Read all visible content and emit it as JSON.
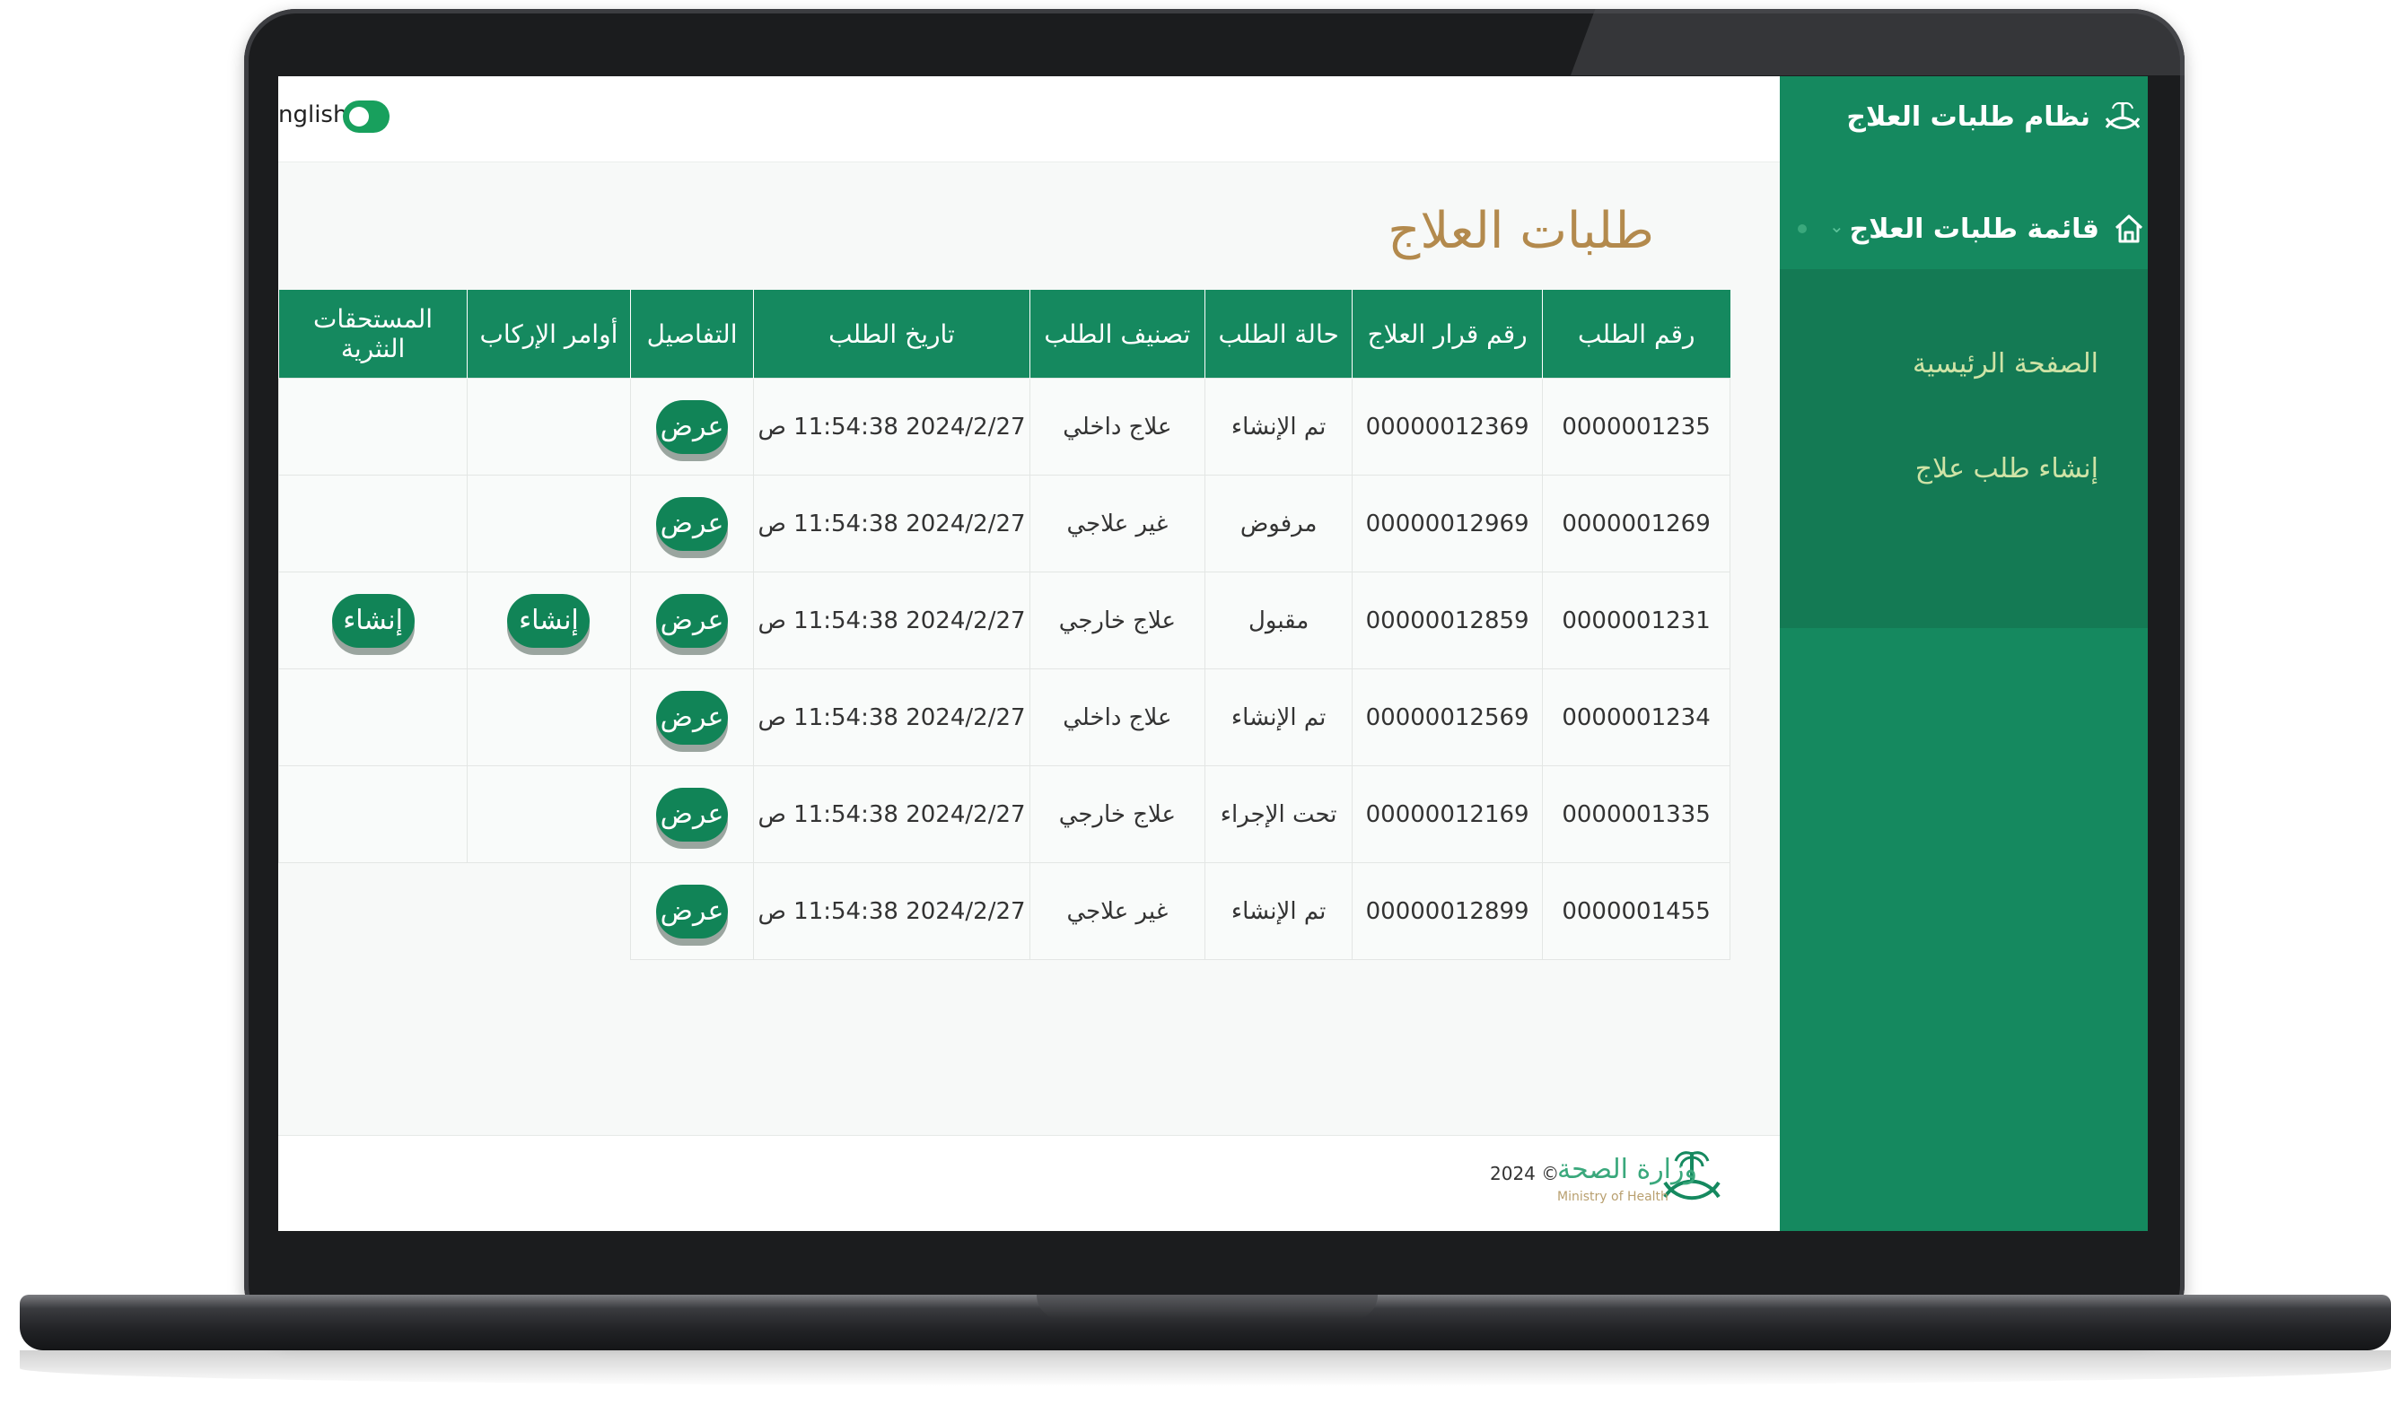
{
  "app": {
    "title": "نظام طلبات العلاج",
    "language_toggle_label": "nglish"
  },
  "sidebar": {
    "main_item": "قائمة طلبات العلاج",
    "items": [
      {
        "label": "الصفحة الرئيسية"
      },
      {
        "label": "إنشاء طلب علاج"
      }
    ]
  },
  "page": {
    "title": "طلبات العلاج"
  },
  "table": {
    "columns": [
      "رقم الطلب",
      "رقم قرار العلاج",
      "حالة الطلب",
      "تصنيف الطلب",
      "تاريخ الطلب",
      "التفاصيل",
      "أوامر الإركاب",
      "المستحقات النثرية"
    ],
    "rows": [
      {
        "id": "0000001235",
        "decision": "00000012369",
        "status": "تم الإنشاء",
        "category": "علاج داخلي",
        "date": "2024/2/27 11:54:38 ص",
        "details": "عرض",
        "boarding": "",
        "expenses": ""
      },
      {
        "id": "0000001269",
        "decision": "00000012969",
        "status": "مرفوض",
        "category": "غير علاجي",
        "date": "2024/2/27 11:54:38 ص",
        "details": "عرض",
        "boarding": "",
        "expenses": ""
      },
      {
        "id": "0000001231",
        "decision": "00000012859",
        "status": "مقبول",
        "category": "علاج خارجي",
        "date": "2024/2/27 11:54:38 ص",
        "details": "عرض",
        "boarding": "إنشاء",
        "expenses": "إنشاء"
      },
      {
        "id": "0000001234",
        "decision": "00000012569",
        "status": "تم الإنشاء",
        "category": "علاج داخلي",
        "date": "2024/2/27 11:54:38 ص",
        "details": "عرض",
        "boarding": "",
        "expenses": ""
      },
      {
        "id": "0000001335",
        "decision": "00000012169",
        "status": "تحت الإجراء",
        "category": "علاج خارجي",
        "date": "2024/2/27 11:54:38 ص",
        "details": "عرض",
        "boarding": "",
        "expenses": ""
      },
      {
        "id": "0000001455",
        "decision": "00000012899",
        "status": "تم الإنشاء",
        "category": "غير علاجي",
        "date": "2024/2/27 11:54:38 ص",
        "details": "عرض",
        "boarding": "",
        "expenses": ""
      }
    ]
  },
  "footer": {
    "ministry_name": "وزارة الصحة",
    "ministry_name_en": "Ministry of Health",
    "copyright": "2024 ©"
  },
  "colors": {
    "primary": "#15895f",
    "button": "#118457",
    "title": "#b38a4d",
    "submenu_text": "#cfe3a6"
  }
}
